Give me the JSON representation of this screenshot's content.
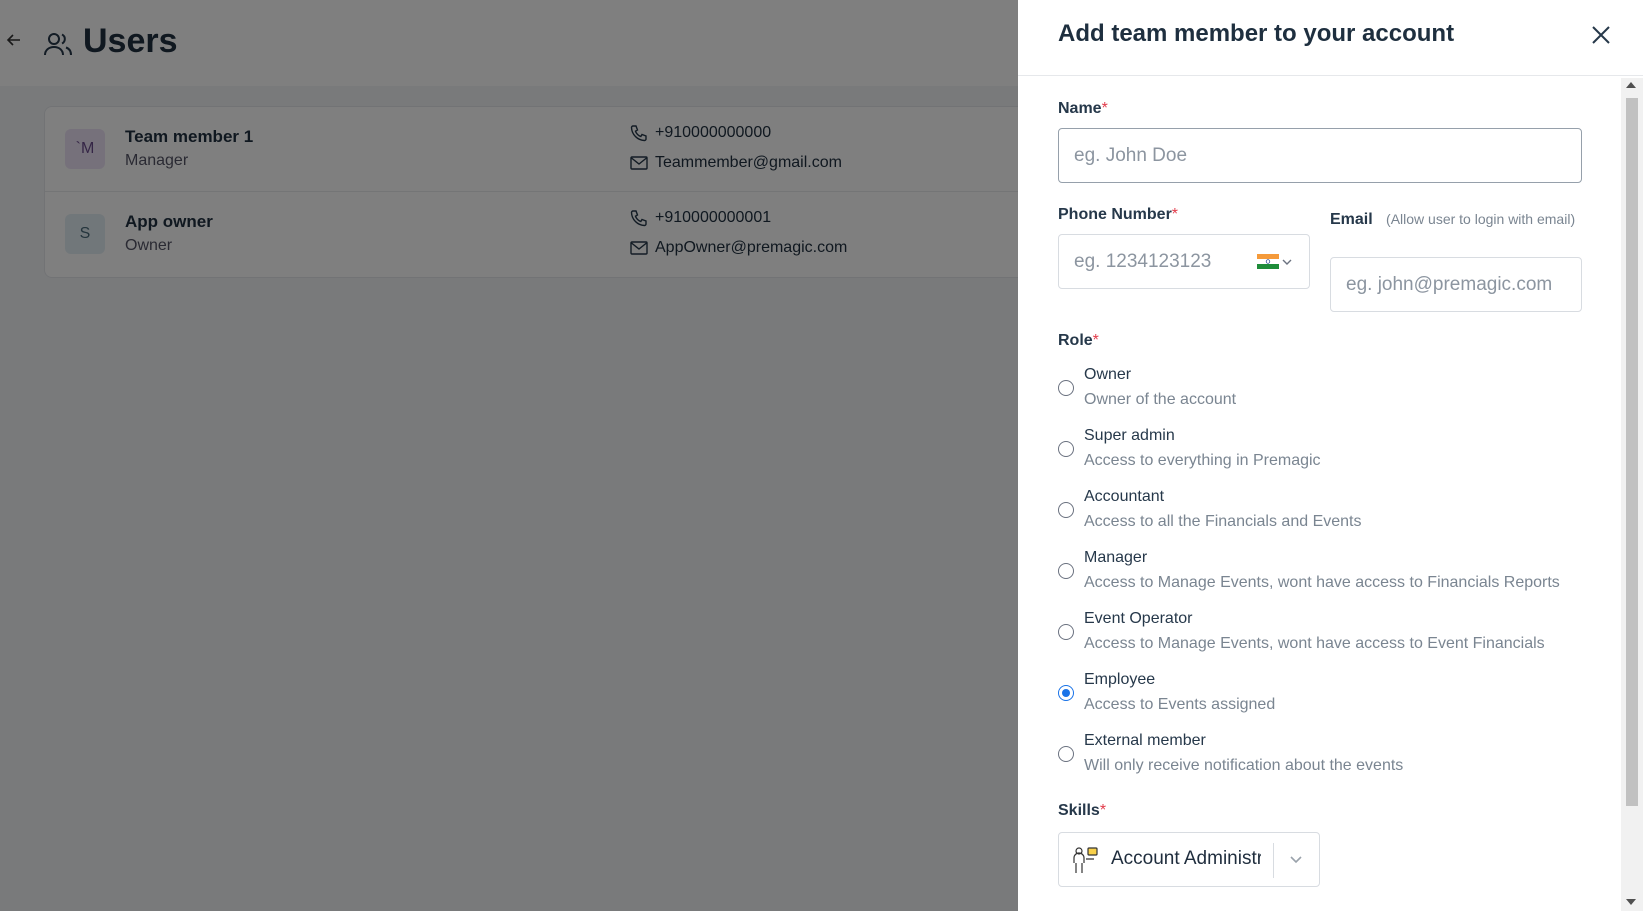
{
  "page": {
    "title": "Users",
    "users": [
      {
        "initial": "`M",
        "name": "Team member 1",
        "role": "Manager",
        "phone": "+910000000000",
        "email": "Teammember@gmail.com"
      },
      {
        "initial": "S",
        "name": "App owner",
        "role": "Owner",
        "phone": "+910000000001",
        "email": "AppOwner@premagic.com"
      }
    ]
  },
  "drawer": {
    "title": "Add team member to your account",
    "name_label": "Name",
    "name_placeholder": "eg. John Doe",
    "phone_label": "Phone Number",
    "phone_placeholder": "eg. 1234123123",
    "email_label": "Email",
    "email_hint": "(Allow user to login with email)",
    "email_placeholder": "eg. john@premagic.com",
    "required_mark": "*",
    "role_label": "Role",
    "roles": [
      {
        "title": "Owner",
        "desc": "Owner of the account",
        "checked": false
      },
      {
        "title": "Super admin",
        "desc": "Access to everything in Premagic",
        "checked": false
      },
      {
        "title": "Accountant",
        "desc": "Access to all the Financials and Events",
        "checked": false
      },
      {
        "title": "Manager",
        "desc": "Access to Manage Events, wont have access to Financials Reports",
        "checked": false
      },
      {
        "title": "Event Operator",
        "desc": "Access to Manage Events, wont have access to Event Financials",
        "checked": false
      },
      {
        "title": "Employee",
        "desc": "Access to Events assigned",
        "checked": true
      },
      {
        "title": "External member",
        "desc": "Will only receive notification about the events",
        "checked": false
      }
    ],
    "skills_label": "Skills",
    "skills_value": "Account Administrator"
  },
  "colors": {
    "accent": "#1a73e8",
    "required": "#e23b4a",
    "overlay": "rgba(0,0,0,0.5)"
  }
}
